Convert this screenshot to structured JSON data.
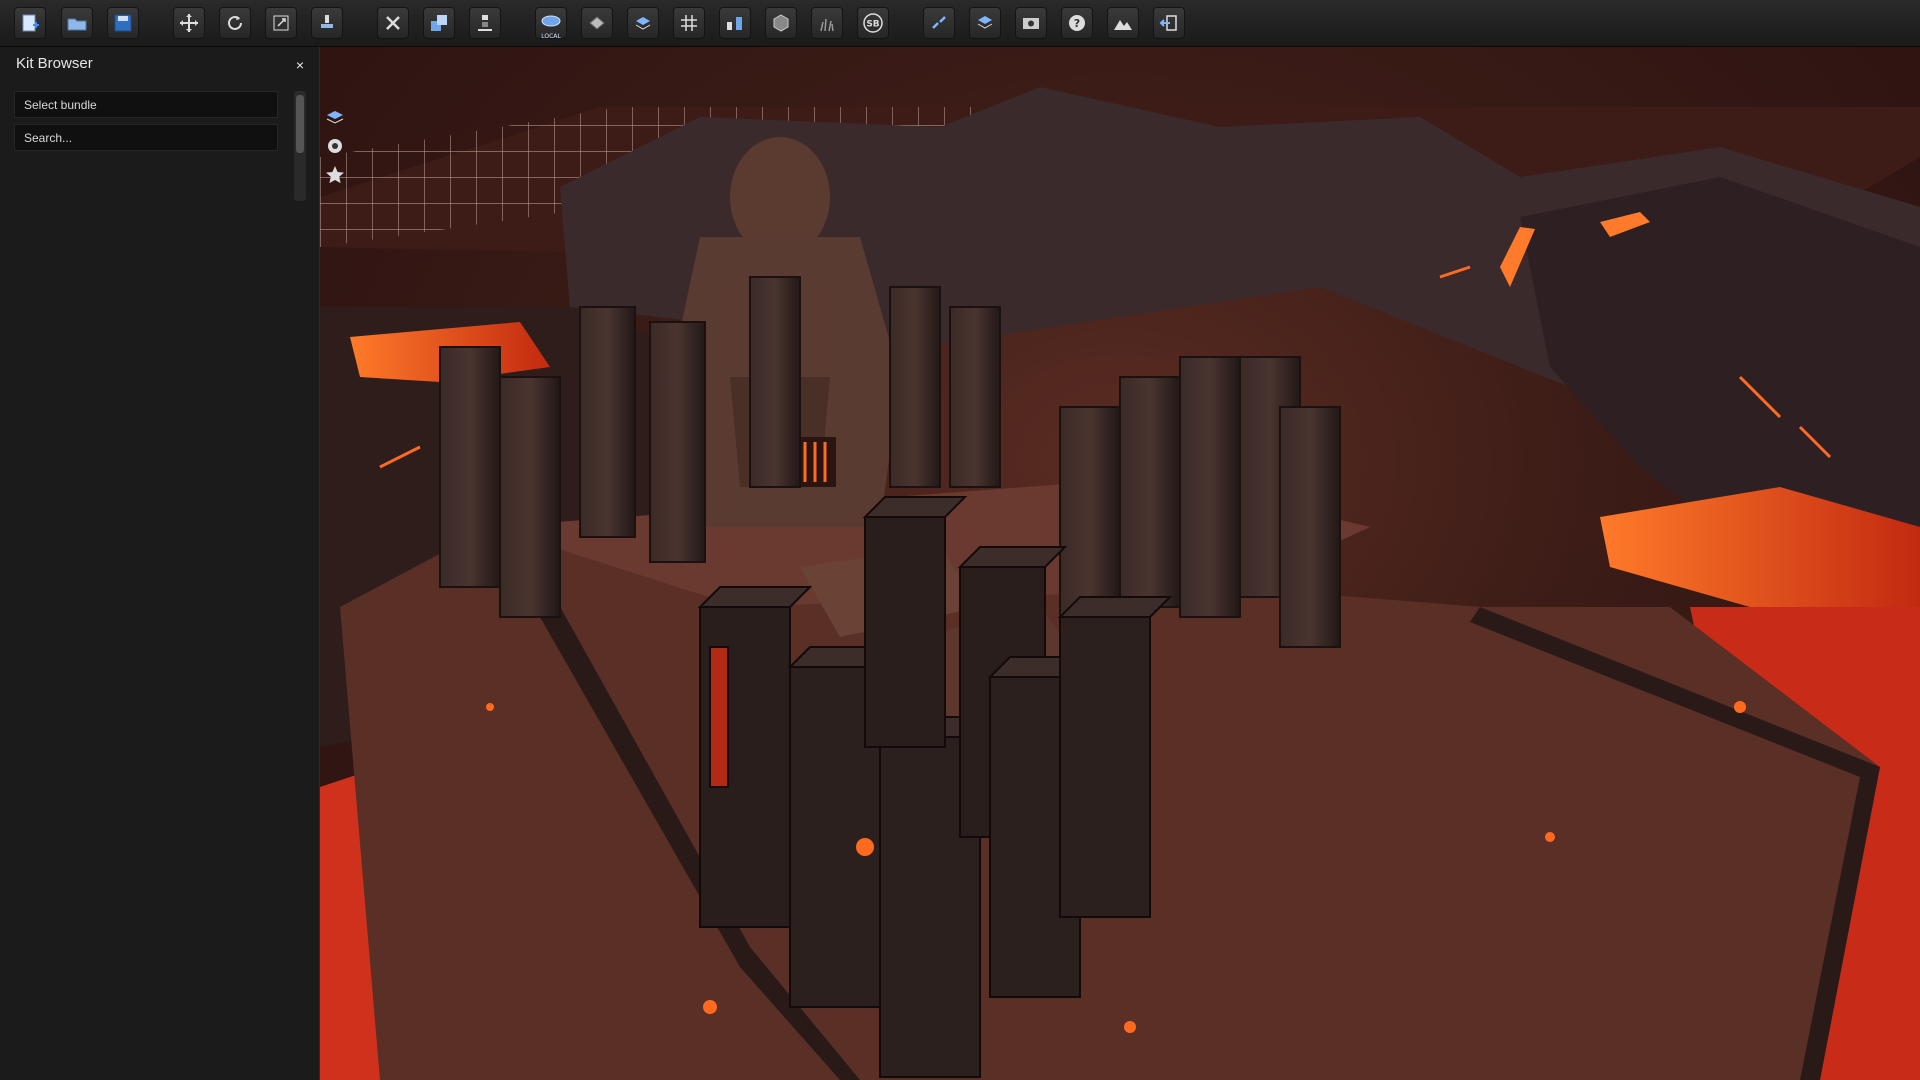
{
  "toolbar": {
    "buttons": [
      {
        "name": "new-icon"
      },
      {
        "name": "open-icon"
      },
      {
        "name": "save-icon"
      },
      {
        "name": "move-icon"
      },
      {
        "name": "rotate-icon"
      },
      {
        "name": "scale-icon"
      },
      {
        "name": "paint-icon"
      },
      {
        "name": "delete-icon"
      },
      {
        "name": "duplicate-icon"
      },
      {
        "name": "align-icon"
      },
      {
        "name": "local-space-icon",
        "sublabel": "LOCAL"
      },
      {
        "name": "snap-icon"
      },
      {
        "name": "layers-icon"
      },
      {
        "name": "grid-icon"
      },
      {
        "name": "terrain-tool-icon"
      },
      {
        "name": "cube-icon"
      },
      {
        "name": "grass-icon"
      },
      {
        "name": "sb-icon",
        "text": "SB"
      },
      {
        "name": "link-icon"
      },
      {
        "name": "bundle-icon"
      },
      {
        "name": "camera-icon"
      },
      {
        "name": "help-icon"
      },
      {
        "name": "mountain-icon"
      },
      {
        "name": "exit-icon"
      }
    ]
  },
  "kit_browser": {
    "title": "Kit Browser",
    "close_label": "×",
    "bundle_select": "Select bundle",
    "search_placeholder": "Search..."
  },
  "colors": {
    "lava": "#ff5a1f",
    "panel_bg": "#1b1b1b",
    "toolbar_bg": "#222222",
    "accent_icon": "#7fb6ff"
  }
}
